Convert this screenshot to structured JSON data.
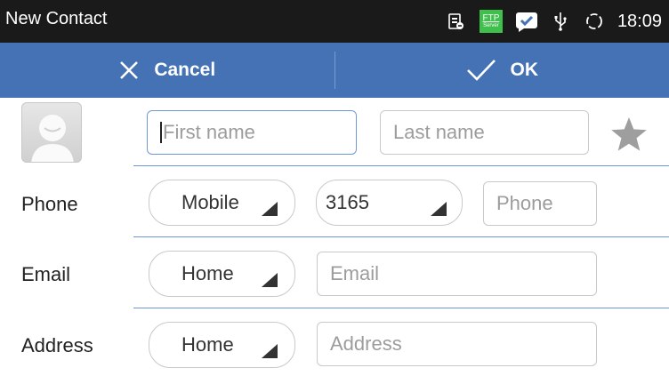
{
  "statusbar": {
    "title": "New Contact",
    "time": "18:09",
    "icons": [
      "sim-icon",
      "ftp-server-icon",
      "chat-icon",
      "usb-icon",
      "sync-icon"
    ],
    "ftp_text": "FTP",
    "ftp_sub": "Server"
  },
  "actionbar": {
    "cancel_label": "Cancel",
    "ok_label": "OK",
    "color": "#4472b5"
  },
  "name": {
    "first_placeholder": "First name",
    "last_placeholder": "Last name",
    "favorite_icon": "star-icon"
  },
  "phone": {
    "label": "Phone",
    "type": "Mobile",
    "prefix": "3165",
    "placeholder": "Phone"
  },
  "email": {
    "label": "Email",
    "type": "Home",
    "placeholder": "Email"
  },
  "address": {
    "label": "Address",
    "type": "Home",
    "placeholder": "Address"
  },
  "colors": {
    "accent": "#6f99d6",
    "statusbar": "#1a1a1a"
  }
}
